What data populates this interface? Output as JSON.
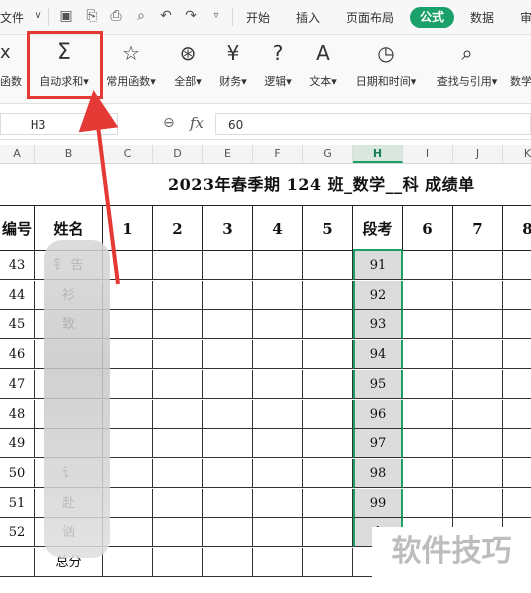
{
  "menubar": {
    "file": "文件",
    "tabs": [
      "开始",
      "插入",
      "页面布局",
      "公式",
      "数据",
      "审"
    ],
    "active_tab": "公式",
    "accent_color": "#1aa068"
  },
  "ribbon": {
    "items": [
      {
        "label": "x\n函数",
        "short": "函数",
        "icon": "fx-icon"
      },
      {
        "label": "自动求和",
        "icon": "sigma-icon"
      },
      {
        "label": "常用函数",
        "icon": "star-icon"
      },
      {
        "label": "全部",
        "icon": "asterisk-icon"
      },
      {
        "label": "财务",
        "icon": "yen-icon"
      },
      {
        "label": "逻辑",
        "icon": "question-icon"
      },
      {
        "label": "文本",
        "icon": "text-icon"
      },
      {
        "label": "日期和时间",
        "icon": "clock-icon"
      },
      {
        "label": "查找与引用",
        "icon": "search-icon"
      },
      {
        "label": "数学",
        "icon": "math-icon"
      }
    ],
    "highlight_color": "#e53935"
  },
  "formula_bar": {
    "name_box": "H3",
    "fx": "fx",
    "value": "60"
  },
  "columns": [
    "A",
    "B",
    "C",
    "D",
    "E",
    "F",
    "G",
    "H",
    "I",
    "J",
    "K"
  ],
  "selected_column": "H",
  "sheet": {
    "title": "2023年春季期  124  班_数学__科  成绩单",
    "headers": [
      "编号",
      "姓名",
      "1",
      "2",
      "3",
      "4",
      "5",
      "段考",
      "6",
      "7",
      "8"
    ],
    "rows": [
      {
        "id": "43",
        "name": "钅  告",
        "h": "91"
      },
      {
        "id": "44",
        "name": "  衫",
        "h": "92"
      },
      {
        "id": "45",
        "name": "  致",
        "h": "93"
      },
      {
        "id": "46",
        "name": "  ",
        "h": "94"
      },
      {
        "id": "47",
        "name": "",
        "h": "95"
      },
      {
        "id": "48",
        "name": "",
        "h": "96"
      },
      {
        "id": "49",
        "name": "",
        "h": "97"
      },
      {
        "id": "50",
        "name": "讠",
        "h": "98"
      },
      {
        "id": "51",
        "name": "赴",
        "h": "99"
      },
      {
        "id": "52",
        "name": "讻",
        "h": "1"
      }
    ],
    "total_label": "总分"
  },
  "watermark": "软件技巧"
}
